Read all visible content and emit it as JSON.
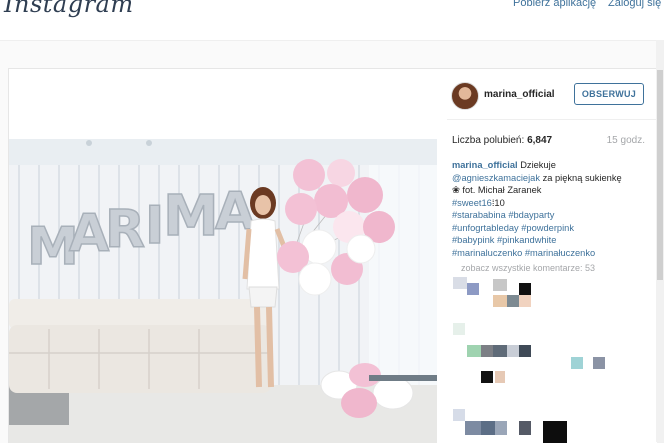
{
  "header": {
    "logo_text": "Instagram",
    "nav_get_app": "Pobierz aplikację",
    "nav_login": "Zaloguj się"
  },
  "post": {
    "username": "marina_official",
    "follow_label": "OBSERWUJ",
    "likes_label": "Liczba polubień: ",
    "likes_count": "6,847",
    "time_ago": "15 godz.",
    "caption": {
      "user": "marina_official",
      "text1": " Dziekuje ",
      "mention": "@agnieszkamaciejak",
      "text2": " za piękną sukienkę",
      "emoji": "❀",
      "text3": " fot. Michał Zaranek",
      "line_sweet": "#sweet16",
      "sweet_suffix": "⁞10",
      "line_tags1": "#starababina #bdayparty",
      "line_tags2": "#unfogrtableday #powderpink",
      "line_tags3": "#babypink #pinkandwhite",
      "line_tags4": "#marinaluczenko #marinałuczenko"
    },
    "view_all_comments": "zobacz wszystkie komentarze: 53",
    "balloon_letters": [
      "M",
      "A",
      "R",
      "I",
      "M",
      "A"
    ]
  },
  "colors": {
    "link_blue": "#3f729b",
    "balloon_pink": "#f0b7cd",
    "muted_text": "#a5a7aa"
  }
}
